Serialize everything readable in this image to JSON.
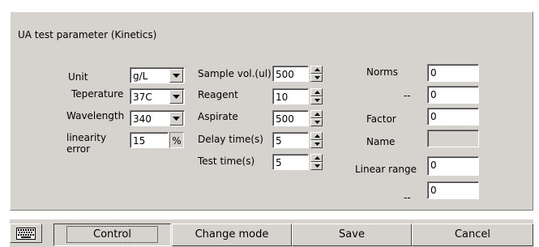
{
  "panel": {
    "title": "UA test parameter (Kinetics)"
  },
  "left": {
    "unit": {
      "label": "Unit",
      "value": "g/L"
    },
    "temperature": {
      "label": "Teperature",
      "value": "37C"
    },
    "wavelength": {
      "label": "Wavelength",
      "value": "340"
    },
    "linearity": {
      "label_line1": "linearity",
      "label_line2": "error",
      "value": "15",
      "unit": "%"
    }
  },
  "middle": {
    "sample_vol": {
      "label": "Sample vol.(ul)",
      "value": "500"
    },
    "reagent": {
      "label": "Reagent",
      "value": "10"
    },
    "aspirate": {
      "label": "Aspirate",
      "value": "500"
    },
    "delay_time": {
      "label": "Delay time(s)",
      "value": "5"
    },
    "test_time": {
      "label": "Test time(s)",
      "value": "5"
    }
  },
  "right": {
    "norms": {
      "label": "Norms",
      "value": "0"
    },
    "norms_hi": {
      "label": "--",
      "value": "0"
    },
    "factor": {
      "label": "Factor",
      "value": "0"
    },
    "name": {
      "label": "Name",
      "value": ""
    },
    "linear_range": {
      "label": "Linear range",
      "value": "0"
    },
    "linear_range_hi": {
      "label": "--",
      "value": "0"
    }
  },
  "bottom": {
    "keyboard_icon": "keyboard-icon",
    "buttons": [
      "Control",
      "Change mode",
      "Save",
      "Cancel"
    ]
  },
  "colors": {
    "face": "#d6d3ce",
    "field": "#ffffff"
  }
}
